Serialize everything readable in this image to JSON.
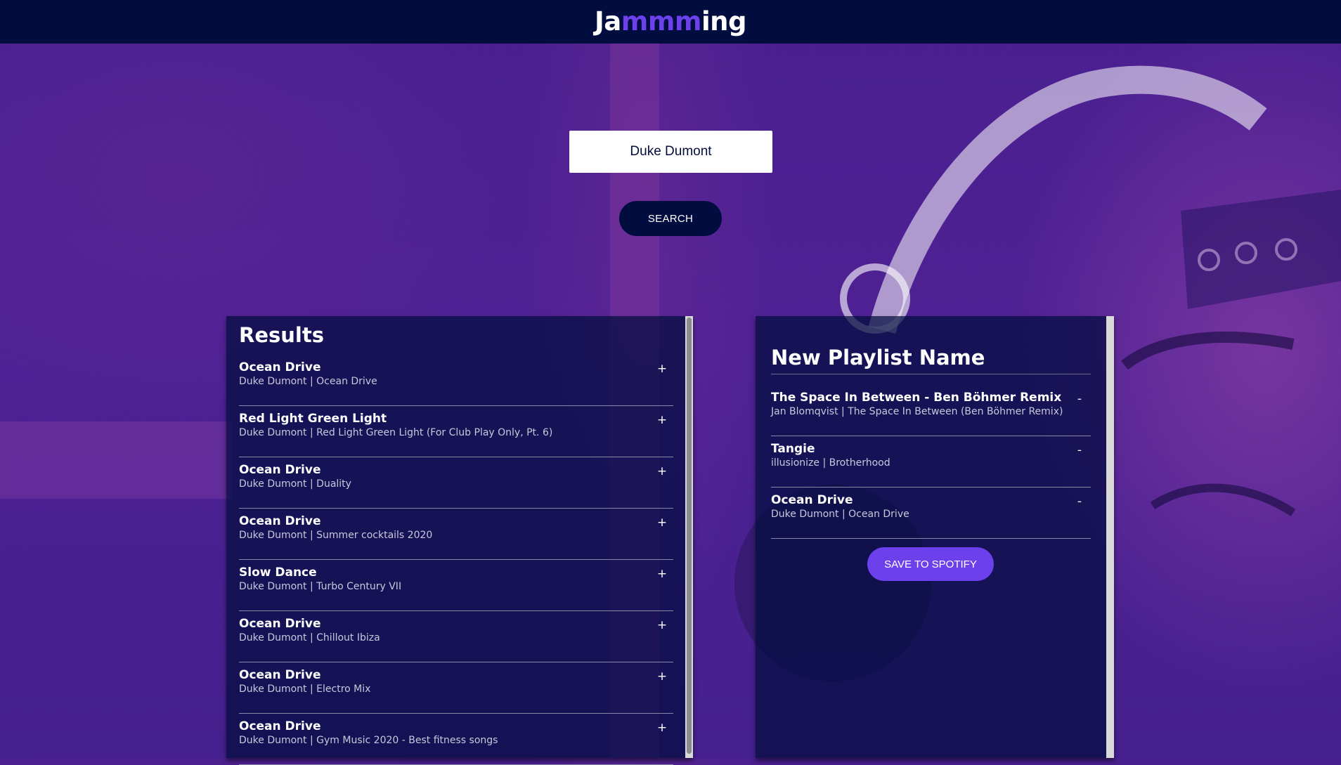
{
  "header": {
    "logo_prefix": "Ja",
    "logo_accent": "mmm",
    "logo_suffix": "ing"
  },
  "search": {
    "value": "Duke Dumont",
    "button_label": "SEARCH"
  },
  "results": {
    "title": "Results",
    "tracks": [
      {
        "name": "Ocean Drive",
        "info": "Duke Dumont | Ocean Drive",
        "action": "+"
      },
      {
        "name": "Red Light Green Light",
        "info": "Duke Dumont | Red Light Green Light (For Club Play Only, Pt. 6)",
        "action": "+"
      },
      {
        "name": "Ocean Drive",
        "info": "Duke Dumont | Duality",
        "action": "+"
      },
      {
        "name": "Ocean Drive",
        "info": "Duke Dumont | Summer cocktails 2020",
        "action": "+"
      },
      {
        "name": "Slow Dance",
        "info": "Duke Dumont | Turbo Century VII",
        "action": "+"
      },
      {
        "name": "Ocean Drive",
        "info": "Duke Dumont | Chillout Ibiza",
        "action": "+"
      },
      {
        "name": "Ocean Drive",
        "info": "Duke Dumont | Electro Mix",
        "action": "+"
      },
      {
        "name": "Ocean Drive",
        "info": "Duke Dumont | Gym Music 2020 - Best fitness songs",
        "action": "+"
      }
    ]
  },
  "playlist": {
    "name": "New Playlist Name",
    "tracks": [
      {
        "name": "The Space In Between - Ben Böhmer Remix",
        "info": "Jan Blomqvist | The Space In Between (Ben Böhmer Remix)",
        "action": "-"
      },
      {
        "name": "Tangie",
        "info": "illusionize | Brotherhood",
        "action": "-"
      },
      {
        "name": "Ocean Drive",
        "info": "Duke Dumont | Ocean Drive",
        "action": "-"
      }
    ],
    "save_label": "SAVE TO SPOTIFY"
  },
  "colors": {
    "header_bg": "#010c3f",
    "accent": "#6c41ec",
    "background": "#4a1f8f"
  }
}
